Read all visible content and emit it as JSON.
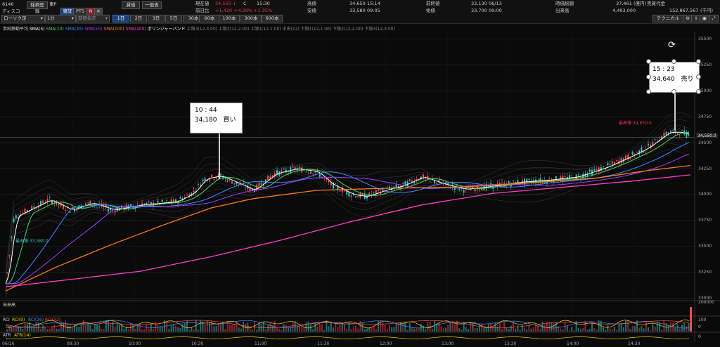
{
  "header": {
    "code": "6146",
    "name": "ディスコ",
    "market": "東P",
    "tab_register": "銘柄登録",
    "tab_east": "東証",
    "tab_pts": "PTS",
    "tab_n": "N",
    "tab_lending": "貸借",
    "tab_general": "一般表",
    "chart_type": "ローソク足",
    "interval": "1分",
    "period_placeholder": "期間指定",
    "periods": [
      "1日",
      "2日",
      "3日",
      "5日",
      "30本",
      "60本",
      "100本",
      "300本",
      "600本"
    ],
    "technical_button": "テクニカル"
  },
  "quote": {
    "price_label": "現在値",
    "price": "34,550",
    "arrow": "↓",
    "c_mark": "C",
    "price_time": "15:30",
    "change_label": "前日比",
    "change": "+1,420",
    "change_pct": "+4.29%",
    "change_pct2": "+1.35%",
    "high_label": "高値",
    "high": "34,650",
    "high_time": "15:14",
    "low_label": "安値",
    "low": "33,580",
    "low_time": "09:05",
    "prev_label": "前終値",
    "prev": "33,130",
    "prev_date": "06/13",
    "open_label": "始値",
    "open": "33,700",
    "open_time": "09:00",
    "mcap_label": "時価総額",
    "mcap": "37,461",
    "mcap_unit": "(億円)",
    "volume_label": "出来高",
    "volume": "4,493,000",
    "turnover_label": "売買代金",
    "turnover": "152,867,567",
    "turnover_unit": "(千円)"
  },
  "legend": {
    "title": "単純移動平均",
    "items": [
      {
        "label": "SMA(5)",
        "color": "#ffffff"
      },
      {
        "label": "SMA(10)",
        "color": "#3ddc5a"
      },
      {
        "label": "SMA(30)",
        "color": "#3a8cff"
      },
      {
        "label": "SMA(50)",
        "color": "#9b3dff"
      },
      {
        "label": "SMA(100)",
        "color": "#ff7a1a"
      },
      {
        "label": "SMA(200)",
        "color": "#ff3dc8"
      }
    ],
    "bb_label": "ボリンジャーバンド",
    "bb_items": [
      "上限3(12,3.00)",
      "上限2(12,2.00)",
      "上限1(12,1.00)",
      "中央(12)",
      "下限1(12,1.00)",
      "下限2(12,2.00)",
      "下限3(12,3.00)"
    ]
  },
  "y_axis": [
    "35500",
    "35250",
    "35000",
    "34750",
    "34500",
    "34250",
    "34000",
    "33750",
    "33500",
    "33250",
    "33000"
  ],
  "price_marker": "34,550.0",
  "max_marker": "最高値:34,650.0",
  "min_marker": "最安値:33,580.0",
  "callouts": [
    {
      "time": "10 : 44",
      "text": "34,180　買い"
    },
    {
      "time": "15 : 23",
      "text": "34,640　売り"
    }
  ],
  "volume_panel": {
    "label": "出来高",
    "max_tick": "200000"
  },
  "rci_panel": {
    "labels": [
      "RCI",
      "RCI(9)",
      "RCI(26)",
      "RCI(52)"
    ],
    "ticks": [
      "100",
      "0"
    ]
  },
  "atr_panel": {
    "label": "ATR",
    "param": "ATR(14)",
    "tick": "0"
  },
  "x_axis": [
    "06/16",
    "09:30",
    "10:00",
    "10:30",
    "11:00",
    "11:30",
    "12:00",
    "13:00",
    "13:30",
    "14:00",
    "14:30",
    "15:00"
  ],
  "colors": {
    "up": "#ff4d4d",
    "down": "#34c3c8",
    "sma5": "#ffffff",
    "sma10": "#3ddc5a",
    "sma30": "#3a8cff",
    "sma50": "#9b3dff",
    "sma100": "#ff7a1a",
    "sma200": "#ff3dc8"
  }
}
